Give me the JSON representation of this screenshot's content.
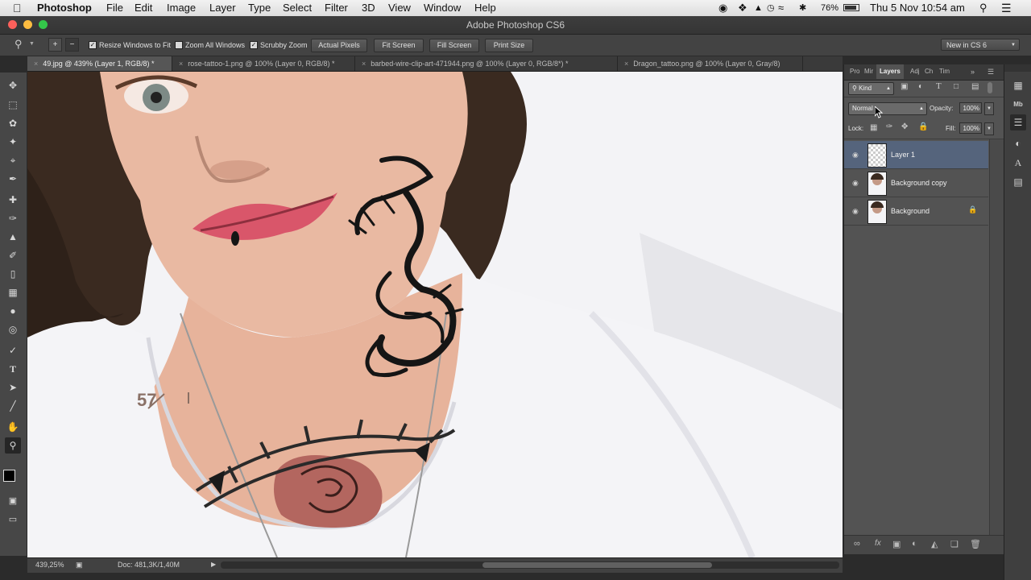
{
  "menubar": {
    "apple_icon": "apple-logo",
    "app_name": "Photoshop",
    "items": [
      "File",
      "Edit",
      "Image",
      "Layer",
      "Type",
      "Select",
      "Filter",
      "3D",
      "View",
      "Window",
      "Help"
    ],
    "battery": "76%",
    "datetime": "Thu 5 Nov  10:54 am"
  },
  "window": {
    "title": "Adobe Photoshop CS6"
  },
  "options_bar": {
    "resize_windows": "Resize Windows to Fit",
    "zoom_all": "Zoom All Windows",
    "scrubby_zoom": "Scrubby Zoom",
    "actual_pixels": "Actual Pixels",
    "fit_screen": "Fit Screen",
    "fill_screen": "Fill Screen",
    "print_size": "Print Size",
    "workspace": "New in CS 6"
  },
  "tabs": [
    {
      "label": "49.jpg @ 439% (Layer 1, RGB/8) *"
    },
    {
      "label": "rose-tattoo-1.png @ 100% (Layer 0, RGB/8) *"
    },
    {
      "label": "barbed-wire-clip-art-471944.png @ 100% (Layer 0, RGB/8*) *"
    },
    {
      "label": "Dragon_tattoo.png @ 100% (Layer 0, Gray/8)"
    }
  ],
  "canvas": {
    "tattoo_number": "57"
  },
  "status": {
    "zoom": "439,25%",
    "doc": "Doc: 481,3K/1,40M"
  },
  "panel": {
    "tabs": [
      "Pro",
      "Mir",
      "Layers",
      "Adj",
      "Ch",
      "Tim"
    ],
    "kind": "Kind",
    "blend_mode": "Normal",
    "opacity_label": "Opacity:",
    "opacity_value": "100%",
    "lock_label": "Lock:",
    "fill_label": "Fill:",
    "fill_value": "100%",
    "layers": [
      {
        "name": "Layer 1"
      },
      {
        "name": "Background copy"
      },
      {
        "name": "Background"
      }
    ]
  }
}
